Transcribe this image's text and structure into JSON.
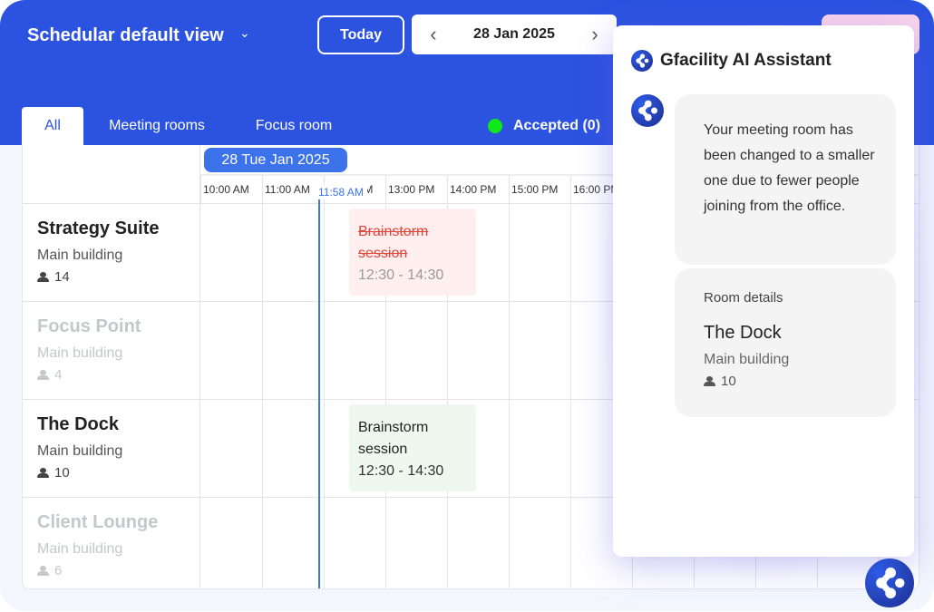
{
  "header": {
    "title": "Schedular default view",
    "today_label": "Today",
    "current_date": "28 Jan 2025",
    "primary_color": "#2c52e0"
  },
  "tabs": [
    {
      "label": "All",
      "active": true
    },
    {
      "label": "Meeting rooms"
    },
    {
      "label": "Focus room"
    }
  ],
  "legend": {
    "accepted_label": "Accepted (0)",
    "accepted_color": "#10e81a"
  },
  "schedule": {
    "day_label": "28 Tue Jan 2025",
    "hours": [
      "10:00 AM",
      "11:00 AM",
      "12:00 PM",
      "13:00 PM",
      "14:00 PM",
      "15:00 PM",
      "16:00 PM"
    ],
    "now_label": "11:58 AM",
    "rooms": [
      {
        "name": "Strategy Suite",
        "building": "Main building",
        "capacity": "14",
        "available": true
      },
      {
        "name": "Focus Point",
        "building": "Main building",
        "capacity": "4",
        "available": false
      },
      {
        "name": "The Dock",
        "building": "Main building",
        "capacity": "10",
        "available": true
      },
      {
        "name": "Client Lounge",
        "building": "Main building",
        "capacity": "6",
        "available": false
      }
    ],
    "events": [
      {
        "room": "Strategy Suite",
        "title": "Brainstorm session",
        "time": "12:30 - 14:30",
        "status": "cancelled"
      },
      {
        "room": "The Dock",
        "title": "Brainstorm session",
        "time": "12:30 - 14:30",
        "status": "booked"
      }
    ]
  },
  "assistant": {
    "title": "Gfacility AI Assistant",
    "message": "Your meeting room has been changed to a smaller one due to fewer people joining from the office.",
    "details_label": "Room details",
    "room_name": "The Dock",
    "room_building": "Main building",
    "room_capacity": "10"
  }
}
